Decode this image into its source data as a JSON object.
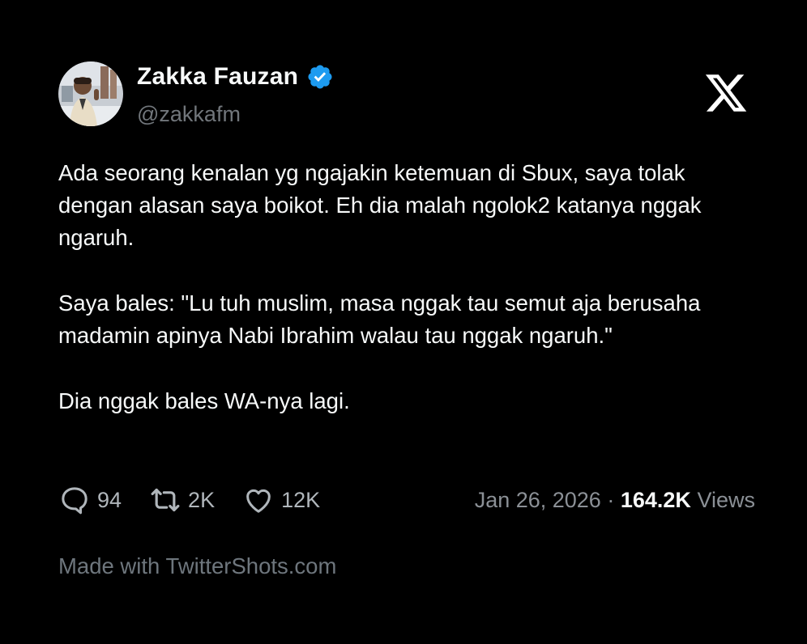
{
  "author": {
    "name": "Zakka Fauzan",
    "handle": "@zakkafm",
    "verified": true,
    "verified_color": "#1d9bf0"
  },
  "platform_icon": "x-logo",
  "tweet": {
    "paragraphs": [
      "Ada seorang kenalan yg ngajakin ketemuan di Sbux, saya tolak dengan alasan saya boikot. Eh dia malah ngolok2 katanya nggak ngaruh.",
      "Saya bales: \"Lu tuh muslim, masa nggak tau semut aja berusaha madamin apinya Nabi Ibrahim walau tau nggak ngaruh.\"",
      "Dia nggak bales WA-nya lagi."
    ]
  },
  "stats": {
    "replies": "94",
    "retweets": "2K",
    "likes": "12K"
  },
  "meta": {
    "date": "Jan 26, 2026",
    "separator": "·",
    "views_count": "164.2K",
    "views_label": "Views"
  },
  "credit": "Made with TwitterShots.com",
  "colors": {
    "background": "#000000",
    "text": "#f7f9f9",
    "muted": "#71767b",
    "accent": "#1d9bf0"
  }
}
